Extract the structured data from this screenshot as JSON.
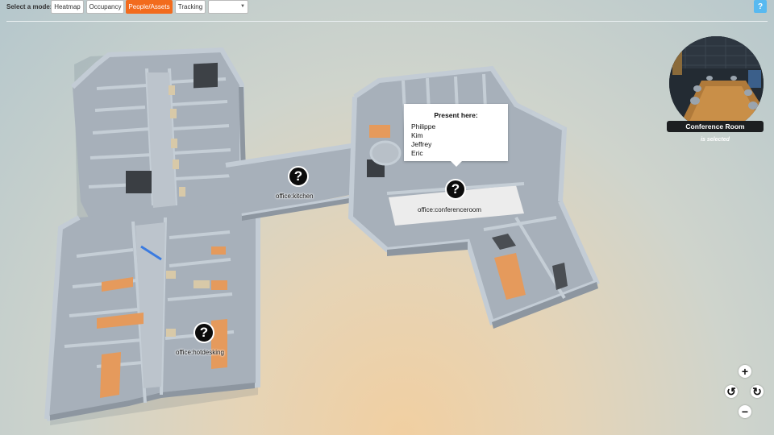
{
  "toolbar": {
    "mode_label": "Select a mode:",
    "modes": [
      {
        "label": "Heatmap",
        "active": false
      },
      {
        "label": "Occupancy",
        "active": false
      },
      {
        "label": "People/Assets",
        "active": true
      },
      {
        "label": "Tracking",
        "active": false
      }
    ],
    "select_value": "",
    "help_label": "?"
  },
  "map": {
    "markers": [
      {
        "icon": "question-mark-icon",
        "glyph": "?",
        "label": "office:kitchen"
      },
      {
        "icon": "question-mark-icon",
        "glyph": "?",
        "label": "office:conferenceroom"
      },
      {
        "icon": "question-mark-icon",
        "glyph": "?",
        "label": "office:hotdesking"
      }
    ],
    "popup": {
      "title": "Present here:",
      "people": [
        "Philippe",
        "Kim",
        "Jeffrey",
        "Eric"
      ]
    }
  },
  "room_preview": {
    "name": "Conference Room",
    "status": "is selected"
  },
  "controls": {
    "zoom_in": "+",
    "zoom_out": "−",
    "rotate_left": "↺",
    "rotate_right": "↻"
  },
  "colors": {
    "accent": "#f26b1d",
    "help": "#58b9f0",
    "wall": "#a4abb3",
    "floor": "#aab3bd",
    "desk": "#e59a5c"
  }
}
